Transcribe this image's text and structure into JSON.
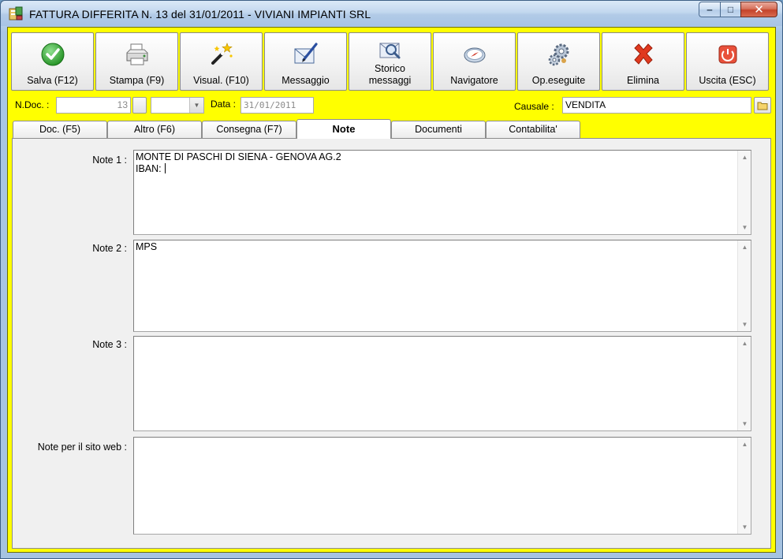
{
  "window": {
    "title": "FATTURA DIFFERITA N. 13  del 31/01/2011 - VIVIANI IMPIANTI SRL",
    "minimize_glyph": "‒",
    "maximize_glyph": "□",
    "close_glyph": "✕"
  },
  "toolbar": {
    "buttons": [
      {
        "id": "salva",
        "label": "Salva (F12)",
        "icon": "check-icon"
      },
      {
        "id": "stampa",
        "label": "Stampa (F9)",
        "icon": "printer-icon"
      },
      {
        "id": "visual",
        "label": "Visual. (F10)",
        "icon": "magic-wand-icon"
      },
      {
        "id": "messaggio",
        "label": "Messaggio",
        "icon": "envelope-pen-icon"
      },
      {
        "id": "storico",
        "label_line1": "Storico",
        "label_line2": "messaggi",
        "icon": "envelope-search-icon"
      },
      {
        "id": "navigatore",
        "label": "Navigatore",
        "icon": "compass-icon"
      },
      {
        "id": "opeseguite",
        "label": "Op.eseguite",
        "icon": "gears-icon"
      },
      {
        "id": "elimina",
        "label": "Elimina",
        "icon": "red-x-icon"
      },
      {
        "id": "uscita",
        "label": "Uscita (ESC)",
        "icon": "power-icon"
      }
    ]
  },
  "docrow": {
    "ndoc_label": "N.Doc. :",
    "ndoc_value": "13",
    "data_label": "Data :",
    "data_value": "31/01/2011",
    "causale_label": "Causale :",
    "causale_value": "VENDITA"
  },
  "tabs": [
    {
      "label": "Doc. (F5)",
      "active": false
    },
    {
      "label": "Altro (F6)",
      "active": false
    },
    {
      "label": "Consegna (F7)",
      "active": false
    },
    {
      "label": "Note",
      "active": true
    },
    {
      "label": "Documenti",
      "active": false
    },
    {
      "label": "Contabilita'",
      "active": false
    }
  ],
  "notes": {
    "note1_label": "Note 1 :",
    "note1_line1": "MONTE DI PASCHI DI SIENA - GENOVA AG.2",
    "note1_line2": "IBAN: ",
    "note2_label": "Note 2 :",
    "note2_value": "MPS",
    "note3_label": "Note 3 :",
    "note3_value": "",
    "web_label": "Note per il sito web :",
    "web_value": ""
  },
  "colors": {
    "client_background": "#ffff00",
    "panel_background": "#f0f0f0"
  }
}
